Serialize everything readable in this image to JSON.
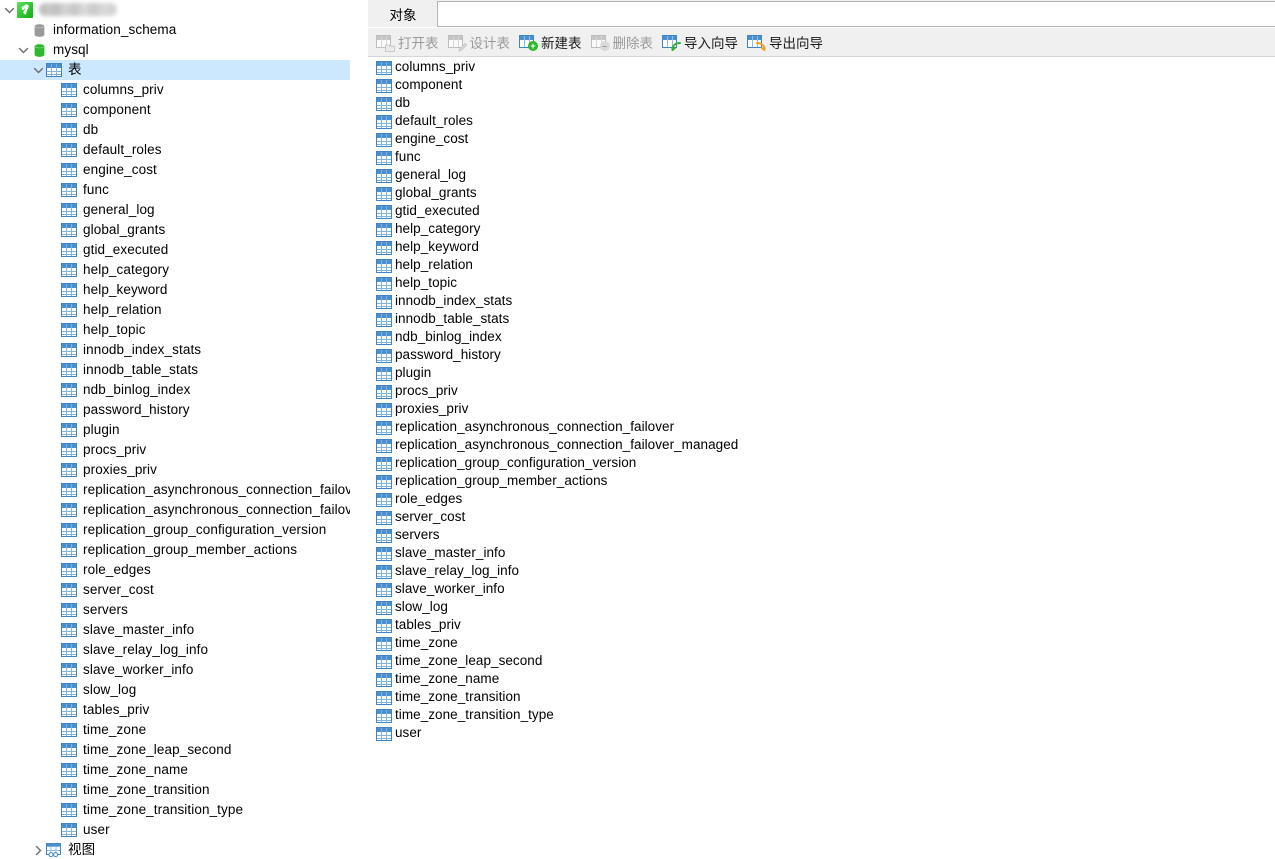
{
  "window": {
    "app": "Navicat",
    "connection_name_redacted": true
  },
  "sidebar": {
    "connection": {
      "label": "",
      "icon": "connection-icon",
      "expanded": true
    },
    "databases": [
      {
        "label": "information_schema",
        "icon": "database-icon",
        "expanded": false,
        "has_twisty": false
      },
      {
        "label": "mysql",
        "icon": "database-icon",
        "expanded": true,
        "has_twisty": true
      }
    ],
    "groups": {
      "tables": {
        "label": "表",
        "icon": "table-icon",
        "expanded": true,
        "selected": true
      },
      "views": {
        "label": "视图",
        "icon": "view-icon",
        "expanded": false,
        "selected": false
      }
    },
    "tables": [
      "columns_priv",
      "component",
      "db",
      "default_roles",
      "engine_cost",
      "func",
      "general_log",
      "global_grants",
      "gtid_executed",
      "help_category",
      "help_keyword",
      "help_relation",
      "help_topic",
      "innodb_index_stats",
      "innodb_table_stats",
      "ndb_binlog_index",
      "password_history",
      "plugin",
      "procs_priv",
      "proxies_priv",
      "replication_asynchronous_connection_failover",
      "replication_asynchronous_connection_failover_managed",
      "replication_group_configuration_version",
      "replication_group_member_actions",
      "role_edges",
      "server_cost",
      "servers",
      "slave_master_info",
      "slave_relay_log_info",
      "slave_worker_info",
      "slow_log",
      "tables_priv",
      "time_zone",
      "time_zone_leap_second",
      "time_zone_name",
      "time_zone_transition",
      "time_zone_transition_type",
      "user"
    ],
    "scrollbar": {
      "orientation": "vertical",
      "position": "top"
    }
  },
  "right_panel": {
    "tabs": [
      {
        "label": "对象",
        "active": true
      }
    ],
    "toolbar": [
      {
        "label": "打开表",
        "icon": "open-table-icon",
        "enabled": false
      },
      {
        "label": "设计表",
        "icon": "design-table-icon",
        "enabled": false
      },
      {
        "label": "新建表",
        "icon": "new-table-icon",
        "enabled": true
      },
      {
        "label": "删除表",
        "icon": "delete-table-icon",
        "enabled": false
      },
      {
        "label": "导入向导",
        "icon": "import-wizard-icon",
        "enabled": true
      },
      {
        "label": "导出向导",
        "icon": "export-wizard-icon",
        "enabled": true
      }
    ],
    "objects": [
      "columns_priv",
      "component",
      "db",
      "default_roles",
      "engine_cost",
      "func",
      "general_log",
      "global_grants",
      "gtid_executed",
      "help_category",
      "help_keyword",
      "help_relation",
      "help_topic",
      "innodb_index_stats",
      "innodb_table_stats",
      "ndb_binlog_index",
      "password_history",
      "plugin",
      "procs_priv",
      "proxies_priv",
      "replication_asynchronous_connection_failover",
      "replication_asynchronous_connection_failover_managed",
      "replication_group_configuration_version",
      "replication_group_member_actions",
      "role_edges",
      "server_cost",
      "servers",
      "slave_master_info",
      "slave_relay_log_info",
      "slave_worker_info",
      "slow_log",
      "tables_priv",
      "time_zone",
      "time_zone_leap_second",
      "time_zone_name",
      "time_zone_transition",
      "time_zone_transition_type",
      "user"
    ]
  },
  "colors": {
    "selection": "#cce8ff",
    "chrome": "#f0f0f0",
    "icon_blue": "#4a90cf",
    "icon_green": "#2eb82e",
    "scroll_thumb": "#cdcdcd"
  }
}
